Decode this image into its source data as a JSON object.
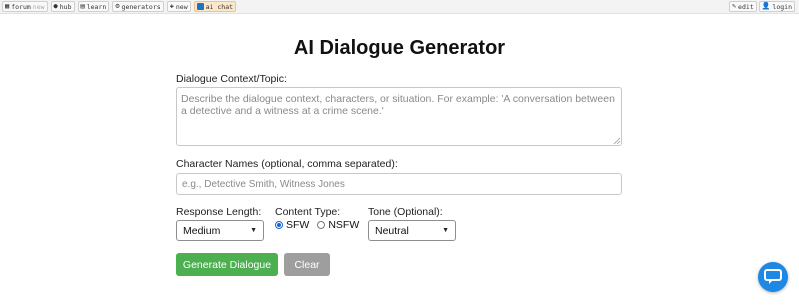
{
  "nav": {
    "left": [
      {
        "icon": "forum-icon",
        "label": "forum",
        "suffix": "new"
      },
      {
        "icon": "hub-icon",
        "label": "hub"
      },
      {
        "icon": "learn-icon",
        "label": "learn"
      },
      {
        "icon": "generators-icon",
        "label": "generators"
      },
      {
        "icon": "new-icon",
        "label": "new"
      },
      {
        "icon": "ai-chat-icon",
        "label": "ai chat",
        "active": true
      }
    ],
    "right": [
      {
        "icon": "edit-icon",
        "label": "edit"
      },
      {
        "icon": "login-icon",
        "label": "login"
      }
    ]
  },
  "page": {
    "title": "AI Dialogue Generator"
  },
  "form": {
    "context_label": "Dialogue Context/Topic:",
    "context_placeholder": "Describe the dialogue context, characters, or situation. For example: 'A conversation between a detective and a witness at a crime scene.'",
    "names_label": "Character Names (optional, comma separated):",
    "names_placeholder": "e.g., Detective Smith, Witness Jones",
    "length_label": "Response Length:",
    "length_value": "Medium",
    "content_label": "Content Type:",
    "content_options": [
      "SFW",
      "NSFW"
    ],
    "content_selected": "SFW",
    "tone_label": "Tone (Optional):",
    "tone_value": "Neutral",
    "generate_label": "Generate Dialogue",
    "clear_label": "Clear"
  },
  "colors": {
    "primary_button": "#4caf50",
    "secondary_button": "#9e9e9e",
    "chat_fab": "#1e88e5",
    "active_tab": "#fde7c9"
  }
}
